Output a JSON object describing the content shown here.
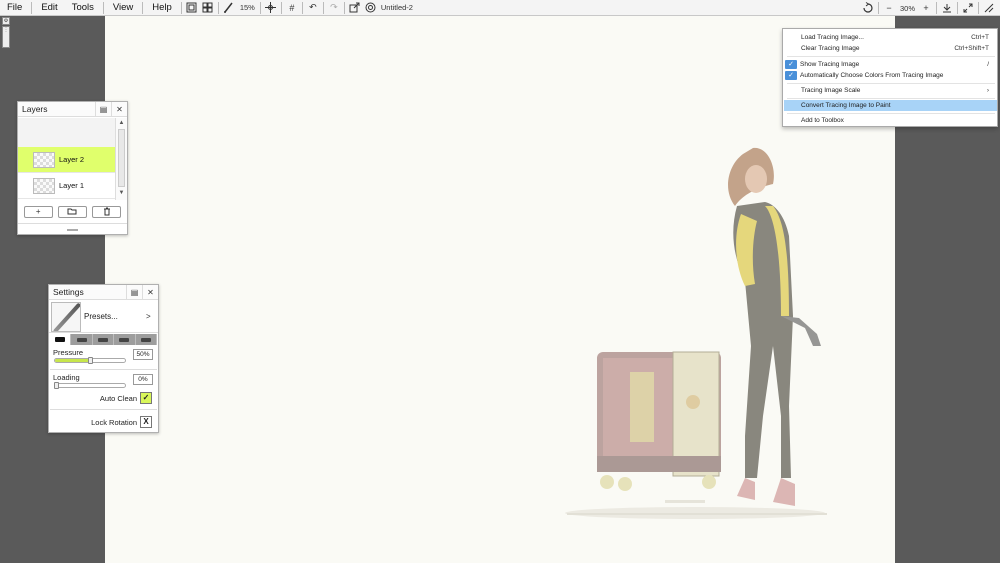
{
  "menu": {
    "file": "File",
    "edit": "Edit",
    "tools": "Tools",
    "view": "View",
    "help": "Help"
  },
  "toolbar": {
    "brush_size": "15%",
    "doc_title": "Untitled-2",
    "zoom": "30%",
    "zoom_minus": "−",
    "zoom_plus": "+"
  },
  "layers_panel": {
    "title": "Layers",
    "layers": [
      {
        "name": "Layer 2",
        "active": true
      },
      {
        "name": "Layer 1",
        "active": false
      }
    ],
    "add_label": "+"
  },
  "settings_panel": {
    "title": "Settings",
    "presets_label": "Presets...",
    "presets_arrow": ">",
    "pressure_label": "Pressure",
    "pressure_value": "50%",
    "pressure_fraction": 0.5,
    "loading_label": "Loading",
    "loading_value": "0%",
    "loading_fraction": 0.0,
    "auto_clean_label": "Auto Clean",
    "auto_clean_mark": "✓",
    "lock_rotation_label": "Lock Rotation",
    "lock_rotation_mark": "X"
  },
  "tracing_menu": {
    "items": [
      {
        "label": "Load Tracing Image...",
        "shortcut": "Ctrl+T",
        "checked": false
      },
      {
        "label": "Clear Tracing Image",
        "shortcut": "Ctrl+Shift+T",
        "checked": false
      },
      {
        "label": "Show Tracing Image",
        "shortcut": "/",
        "checked": true
      },
      {
        "label": "Automatically Choose Colors From Tracing Image",
        "shortcut": "",
        "checked": true
      },
      {
        "label": "Tracing Image Scale",
        "shortcut": "›",
        "checked": false
      },
      {
        "label": "Convert Tracing Image to Paint",
        "shortcut": "",
        "checked": false,
        "highlighted": true
      },
      {
        "label": "Add to Toolbox",
        "shortcut": "",
        "checked": false
      }
    ]
  },
  "colors": {
    "active_layer": "#e0ff6c",
    "menu_highlight": "#a8d3f7",
    "check_blue": "#4a90d9",
    "canvas": "#fafaf5",
    "workspace": "#5a5a5a"
  }
}
